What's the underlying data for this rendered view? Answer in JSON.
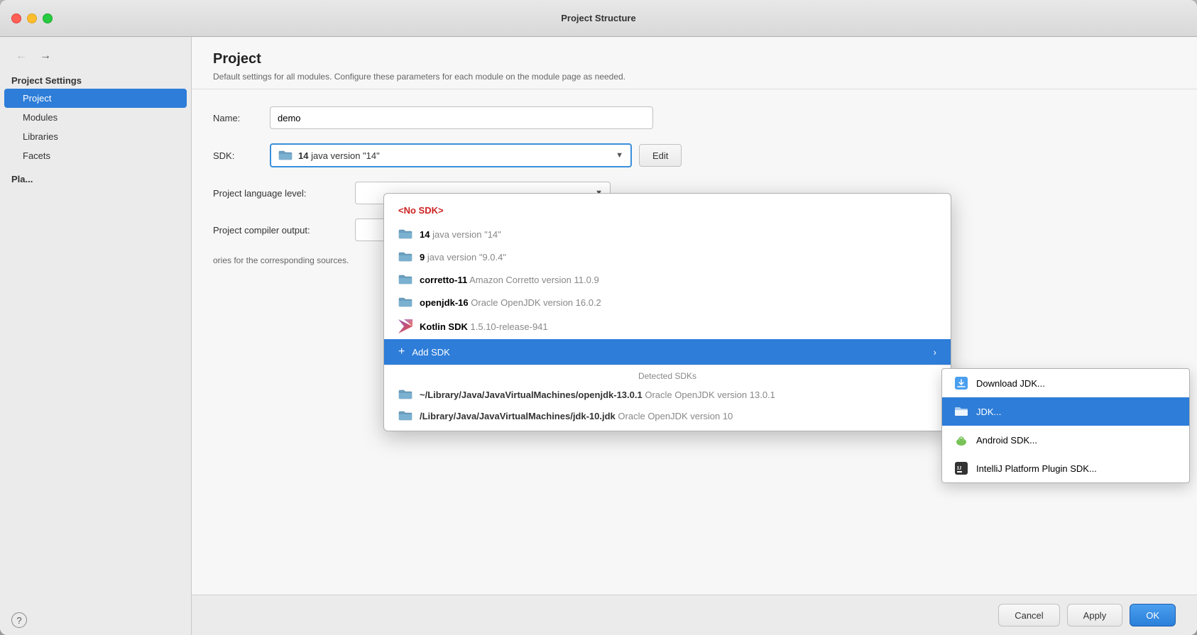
{
  "window": {
    "title": "Project Structure"
  },
  "titlebar": {
    "title": "Project Structure"
  },
  "sidebar": {
    "back_label": "←",
    "forward_label": "→",
    "project_settings_label": "Project Settings",
    "items": [
      {
        "id": "project",
        "label": "Project",
        "active": true
      },
      {
        "id": "modules",
        "label": "Modules",
        "active": false
      },
      {
        "id": "libraries",
        "label": "Libraries",
        "active": false
      },
      {
        "id": "facets",
        "label": "Facets",
        "active": false
      }
    ],
    "platform_label": "Pla...",
    "help_label": "?"
  },
  "panel": {
    "title": "Project",
    "description": "Default settings for all modules. Configure these parameters for each module on the module page as needed.",
    "name_label": "Name:",
    "name_value": "demo",
    "name_placeholder": "demo",
    "sdk_label": "SDK:",
    "sdk_selected": "14 java version \"14\"",
    "sdk_edit_label": "Edit",
    "language_level_label": "Project language level:",
    "compiler_output_label": "Project compiler output:",
    "compiler_output_note": "ories for the corresponding sources."
  },
  "sdk_popup": {
    "no_sdk_label": "<No SDK>",
    "items": [
      {
        "id": "java14",
        "icon": "folder",
        "name": "14",
        "version": "java version \"14\""
      },
      {
        "id": "java9",
        "icon": "folder",
        "name": "9",
        "version": "java version \"9.0.4\""
      },
      {
        "id": "corretto11",
        "icon": "folder",
        "name": "corretto-11",
        "version": "Amazon Corretto version 11.0.9"
      },
      {
        "id": "openjdk16",
        "icon": "folder",
        "name": "openjdk-16",
        "version": "Oracle OpenJDK version 16.0.2"
      },
      {
        "id": "kotlin",
        "icon": "kotlin",
        "name": "Kotlin SDK",
        "version": "1.5.10-release-941"
      }
    ],
    "add_sdk_label": "Add SDK",
    "detected_label": "Detected SDKs",
    "detected_items": [
      {
        "path": "~/Library/Java/JavaVirtualMachines/openjdk-13.0.1",
        "version": "Oracle OpenJDK version 13.0.1"
      },
      {
        "path": "/Library/Java/JavaVirtualMachines/jdk-10.jdk",
        "version": "Oracle OpenJDK version 10"
      }
    ]
  },
  "submenu": {
    "items": [
      {
        "id": "download-jdk",
        "icon": "download",
        "label": "Download JDK..."
      },
      {
        "id": "jdk",
        "icon": "folder",
        "label": "JDK...",
        "selected": true
      },
      {
        "id": "android-sdk",
        "icon": "android",
        "label": "Android SDK..."
      },
      {
        "id": "intellij-sdk",
        "icon": "intellij",
        "label": "IntelliJ Platform Plugin SDK..."
      }
    ]
  },
  "bottom_bar": {
    "cancel_label": "Cancel",
    "apply_label": "Apply",
    "ok_label": "OK"
  }
}
